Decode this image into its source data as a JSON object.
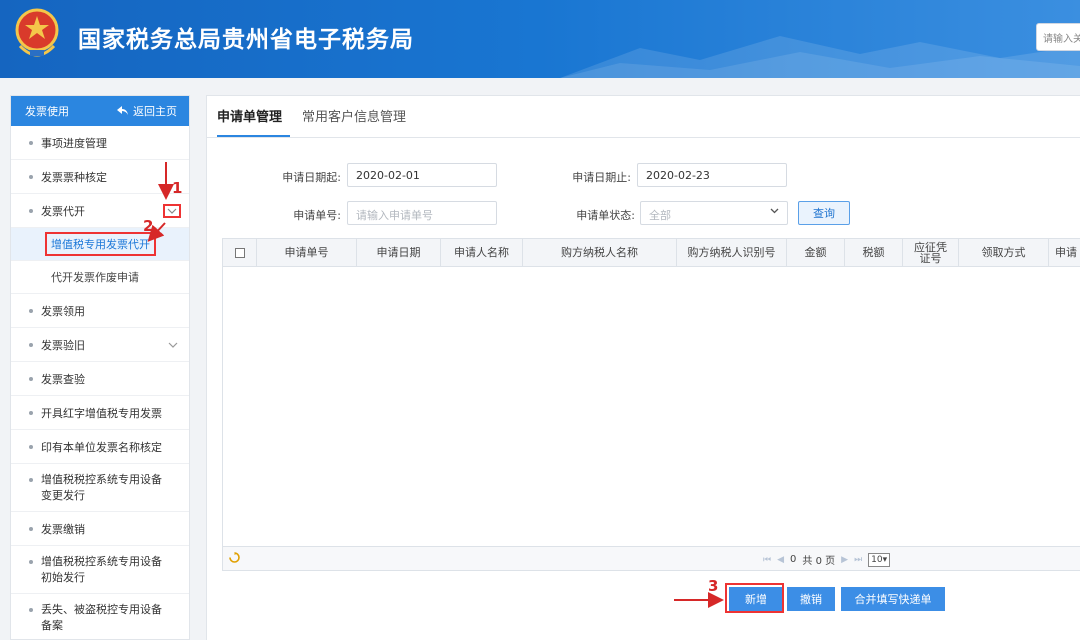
{
  "header": {
    "title": "国家税务总局贵州省电子税务局",
    "search_placeholder": "请输入关"
  },
  "sidebar": {
    "head_label": "发票使用",
    "back_label": "返回主页",
    "items": [
      {
        "label": "事项进度管理"
      },
      {
        "label": "发票票种核定"
      },
      {
        "label": "发票代开"
      },
      {
        "label": "增值税专用发票代开"
      },
      {
        "label": "代开发票作废申请"
      },
      {
        "label": "发票领用"
      },
      {
        "label": "发票验旧"
      },
      {
        "label": "发票查验"
      },
      {
        "label": "开具红字增值税专用发票"
      },
      {
        "label": "印有本单位发票名称核定"
      },
      {
        "label": "增值税税控系统专用设备变更发行"
      },
      {
        "label": "发票缴销"
      },
      {
        "label": "增值税税控系统专用设备初始发行"
      },
      {
        "label": "丢失、被盗税控专用设备备案"
      }
    ]
  },
  "tabs": [
    {
      "label": "申请单管理"
    },
    {
      "label": "常用客户信息管理"
    }
  ],
  "form": {
    "start_label": "申请日期起:",
    "start_value": "2020-02-01",
    "end_label": "申请日期止:",
    "end_value": "2020-02-23",
    "no_label": "申请单号:",
    "no_placeholder": "请输入申请单号",
    "status_label": "申请单状态:",
    "status_value": "全部",
    "query_label": "查询"
  },
  "grid": {
    "columns": [
      "申请单号",
      "申请日期",
      "申请人名称",
      "购方纳税人名称",
      "购方纳税人识别号",
      "金额",
      "税额",
      "应征凭证号",
      "领取方式",
      "申请"
    ],
    "page_current": "0",
    "page_total_text": "共 0 页",
    "page_size": "10"
  },
  "actions": {
    "add": "新增",
    "cancel": "撤销",
    "merge": "合并填写快递单"
  },
  "annotations": {
    "step1": "1",
    "step2": "2",
    "step3": "3"
  }
}
